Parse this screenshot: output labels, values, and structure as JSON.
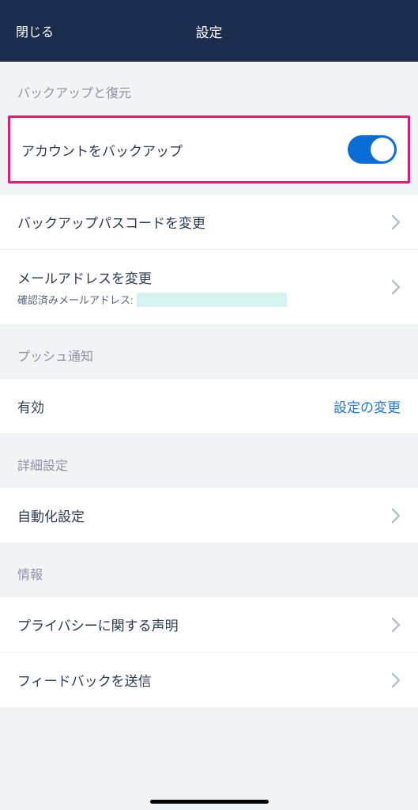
{
  "header": {
    "close_label": "閉じる",
    "title": "設定"
  },
  "sections": {
    "backup": {
      "title": "バックアップと復元",
      "backup_account_label": "アカウントをバックアップ",
      "change_passcode_label": "バックアップパスコードを変更",
      "change_email_label": "メールアドレスを変更",
      "change_email_sub": "確認済みメールアドレス:"
    },
    "push": {
      "title": "プッシュ通知",
      "status": "有効",
      "change_link": "設定の変更"
    },
    "advanced": {
      "title": "詳細設定",
      "automation_label": "自動化設定"
    },
    "info": {
      "title": "情報",
      "privacy_label": "プライバシーに関する声明",
      "feedback_label": "フィードバックを送信"
    }
  }
}
